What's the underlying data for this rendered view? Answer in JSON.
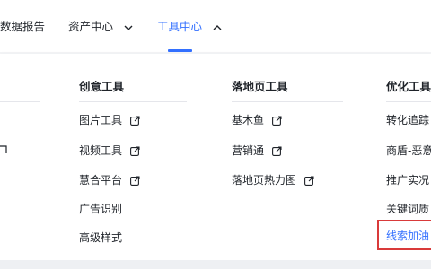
{
  "topnav": {
    "items": [
      {
        "label": "数据报告"
      },
      {
        "label": "资产中心"
      },
      {
        "label": "工具中心"
      }
    ]
  },
  "menu": {
    "columns": [
      {
        "title": "创意工具",
        "items": [
          {
            "label": "图片工具",
            "external": true
          },
          {
            "label": "视频工具",
            "external": true
          },
          {
            "label": "慧合平台",
            "external": true
          },
          {
            "label": "广告识别",
            "external": false
          },
          {
            "label": "高级样式",
            "external": false
          }
        ]
      },
      {
        "title": "落地页工具",
        "items": [
          {
            "label": "基木鱼",
            "external": true
          },
          {
            "label": "营销通",
            "external": true
          },
          {
            "label": "落地页热力图",
            "external": true
          }
        ]
      },
      {
        "title": "优化工具",
        "items": [
          {
            "label": "转化追踪"
          },
          {
            "label": "商盾-恶意"
          },
          {
            "label": "推广实况"
          },
          {
            "label": "关键词质"
          },
          {
            "label": "线索加油"
          }
        ]
      }
    ]
  },
  "colors": {
    "accent": "#3370ff",
    "highlight": "#d93a3a",
    "text": "#1f2329"
  }
}
